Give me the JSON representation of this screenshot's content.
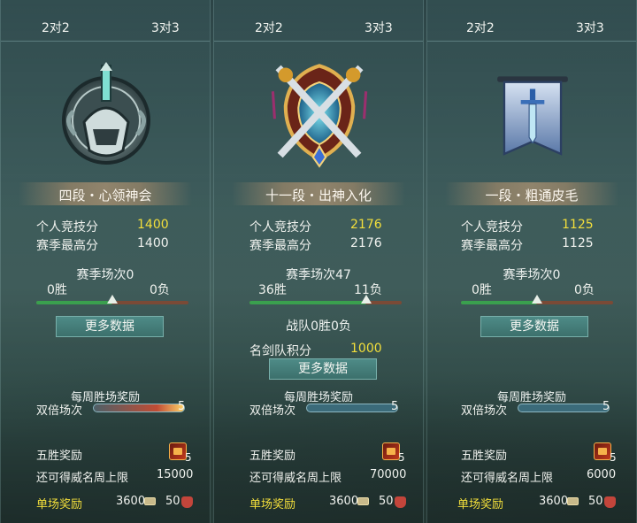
{
  "panels": [
    {
      "tabs": {
        "left": "2对2",
        "right": "3对3"
      },
      "rank_title": "四段・心领神会",
      "personal_score_label": "个人竞技分",
      "personal_score": "1400",
      "season_high_label": "赛季最高分",
      "season_high": "1400",
      "season_matches": "赛季场次0",
      "wins": "0胜",
      "losses": "0负",
      "win_ratio": 0.5,
      "more_data": "更多数据",
      "weekly_reward": "每周胜场奖励",
      "double_label": "双倍场次",
      "double_count": "5",
      "double_progress": 1.0,
      "five_win_label": "五胜奖励",
      "five_win_count": "5",
      "fame_cap_label": "还可得威名周上限",
      "fame_cap": "15000",
      "single_reward_label": "单场奖励",
      "single_coin": "3600",
      "single_seal": "50"
    },
    {
      "tabs": {
        "left": "2对2",
        "right": "3对3"
      },
      "rank_title": "十一段・出神入化",
      "personal_score_label": "个人竞技分",
      "personal_score": "2176",
      "season_high_label": "赛季最高分",
      "season_high": "2176",
      "season_matches": "赛季场次47",
      "wins": "36胜",
      "losses": "11负",
      "win_ratio": 0.766,
      "team_record": "战队0胜0负",
      "team_score_label": "名剑队积分",
      "team_score": "1000",
      "more_data": "更多数据",
      "weekly_reward": "每周胜场奖励",
      "double_label": "双倍场次",
      "double_count": "5",
      "double_progress": 0.0,
      "five_win_label": "五胜奖励",
      "five_win_count": "5",
      "fame_cap_label": "还可得威名周上限",
      "fame_cap": "70000",
      "single_reward_label": "单场奖励",
      "single_coin": "3600",
      "single_seal": "50"
    },
    {
      "tabs": {
        "left": "2对2",
        "right": "3对3"
      },
      "rank_title": "一段・粗通皮毛",
      "personal_score_label": "个人竞技分",
      "personal_score": "1125",
      "season_high_label": "赛季最高分",
      "season_high": "1125",
      "season_matches": "赛季场次0",
      "wins": "0胜",
      "losses": "0负",
      "win_ratio": 0.5,
      "more_data": "更多数据",
      "weekly_reward": "每周胜场奖励",
      "double_label": "双倍场次",
      "double_count": "5",
      "double_progress": 0.0,
      "five_win_label": "五胜奖励",
      "five_win_count": "5",
      "fame_cap_label": "还可得威名周上限",
      "fame_cap": "6000",
      "single_reward_label": "单场奖励",
      "single_coin": "3600",
      "single_seal": "50"
    }
  ],
  "colors": {
    "score_yellow": "#f3df3b",
    "win_green": "#3aa04e",
    "loss_brown": "#7a4a36"
  }
}
